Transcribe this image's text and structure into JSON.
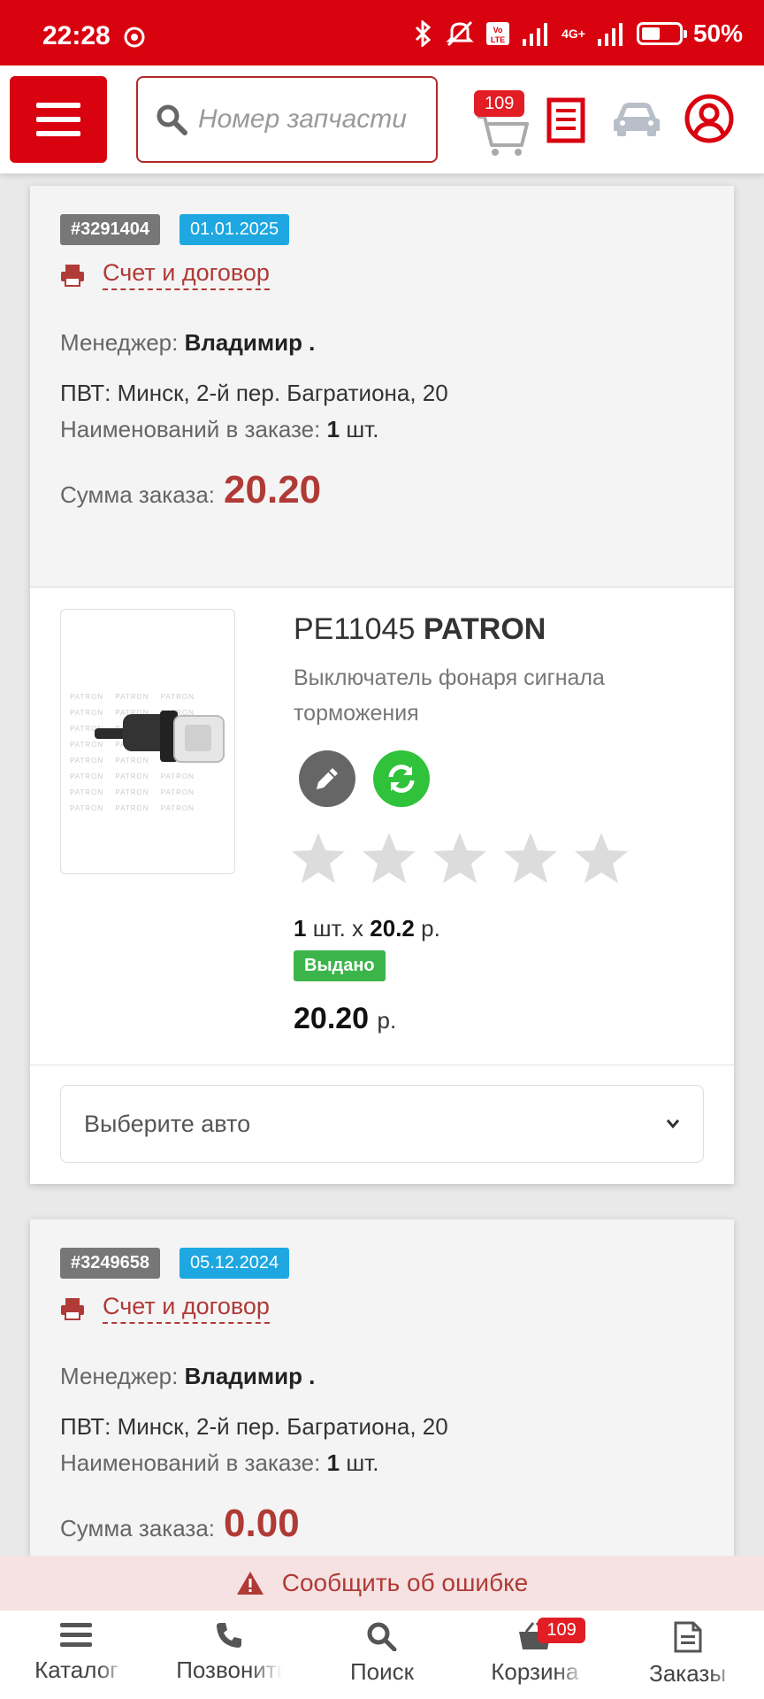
{
  "status_bar": {
    "time": "22:28",
    "network": "4G+",
    "battery": "50%",
    "battery_level": 0.5
  },
  "header": {
    "search_placeholder": "Номер запчасти",
    "cart_count": "109"
  },
  "orders": [
    {
      "id": "#3291404",
      "date": "01.01.2025",
      "doc_link": "Счет и договор",
      "manager_label": "Менеджер:",
      "manager_name": "Владимир .",
      "pickup": "ПВТ: Минск, 2-й пер. Багратиона, 20",
      "items_label": "Наименований в заказе:",
      "items_count": "1",
      "items_unit": "шт.",
      "sum_label": "Сумма заказа:",
      "sum_value": "20.20",
      "item": {
        "code": "PE11045",
        "brand": "PATRON",
        "description": "Выключатель фонаря сигнала торможения",
        "rating": 0,
        "qty": "1",
        "qty_text": "шт. x",
        "unit_price": "20.2",
        "currency": "р.",
        "status": "Выдано",
        "total": "20.20",
        "watermark": "PATRON PATRON PATRON PATRON PATRON PATRON PATRON PATRON PATRON PATRON PATRON PATRON PATRON PATRON PATRON PATRON PATRON PATRON PATRON PATRON PATRON PATRON PATRON PATRON"
      },
      "select_auto": "Выберите авто"
    },
    {
      "id": "#3249658",
      "date": "05.12.2024",
      "doc_link": "Счет и договор",
      "manager_label": "Менеджер:",
      "manager_name": "Владимир .",
      "pickup": "ПВТ: Минск, 2-й пер. Багратиона, 20",
      "items_label": "Наименований в заказе:",
      "items_count": "1",
      "items_unit": "шт.",
      "sum_label": "Сумма заказа:",
      "sum_value": "0.00"
    }
  ],
  "error_bar": {
    "label": "Сообщить об ошибке"
  },
  "bottom_nav": {
    "items": [
      {
        "label": "Каталог",
        "icon": "menu-icon"
      },
      {
        "label": "Позвонить",
        "icon": "phone-icon"
      },
      {
        "label": "Поиск",
        "icon": "search-icon"
      },
      {
        "label": "Корзина",
        "icon": "basket-icon",
        "badge": "109"
      },
      {
        "label": "Заказы",
        "icon": "document-icon"
      }
    ]
  },
  "colors": {
    "brand_red": "#d9020f",
    "link_red": "#b03a36",
    "date_blue": "#1ea7e1",
    "status_green": "#3bb54a"
  }
}
